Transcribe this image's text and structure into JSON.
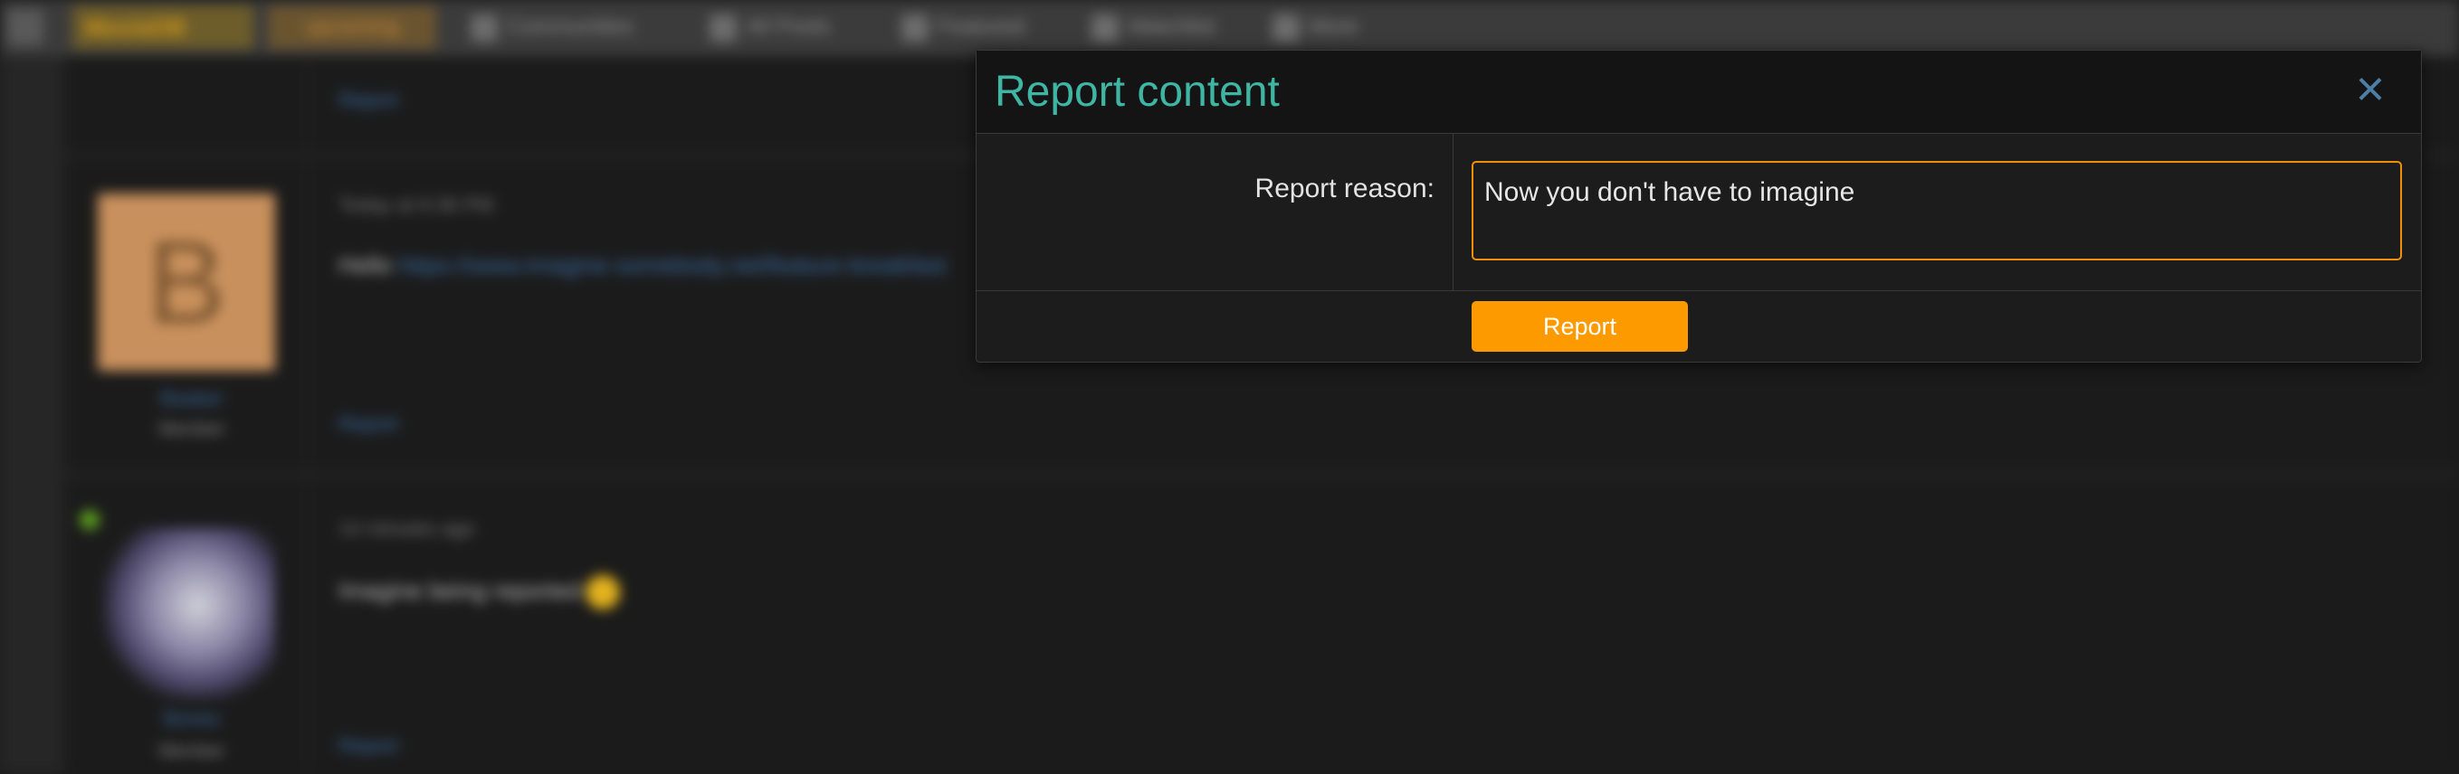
{
  "background": {
    "nav": {
      "logo": "MovieDB",
      "badge": "upcoming",
      "items": [
        {
          "label": "Communities",
          "icon": "grid-icon"
        },
        {
          "label": "All Posts",
          "icon": "chat-icon"
        },
        {
          "label": "Featured",
          "icon": "star-icon"
        },
        {
          "label": "Watchlist",
          "icon": "bookmark-icon"
        },
        {
          "label": "More",
          "icon": "more-icon"
        }
      ]
    },
    "posts": [
      {
        "report_label": "Report"
      },
      {
        "avatar_letter": "B",
        "user": "Beaker",
        "role": "Member",
        "time": "Today at 6:36 PM",
        "text_prefix": "Hello ",
        "link": "https://www.imagine-somebody.net/feature-breakfast",
        "report_label": "Report"
      },
      {
        "user": "Bones",
        "role": "Member",
        "time": "14 minutes ago",
        "text": "Imagine being reported",
        "report_label": "Report"
      }
    ]
  },
  "modal": {
    "title": "Report content",
    "close_icon": "×",
    "reason_label": "Report reason:",
    "reason_value": "Now you don't have to imagine",
    "submit_label": "Report"
  },
  "colors": {
    "accent": "#3fb6a4",
    "button": "#fd9a00",
    "input_border": "#f0900a",
    "close": "#4b7fa6"
  }
}
